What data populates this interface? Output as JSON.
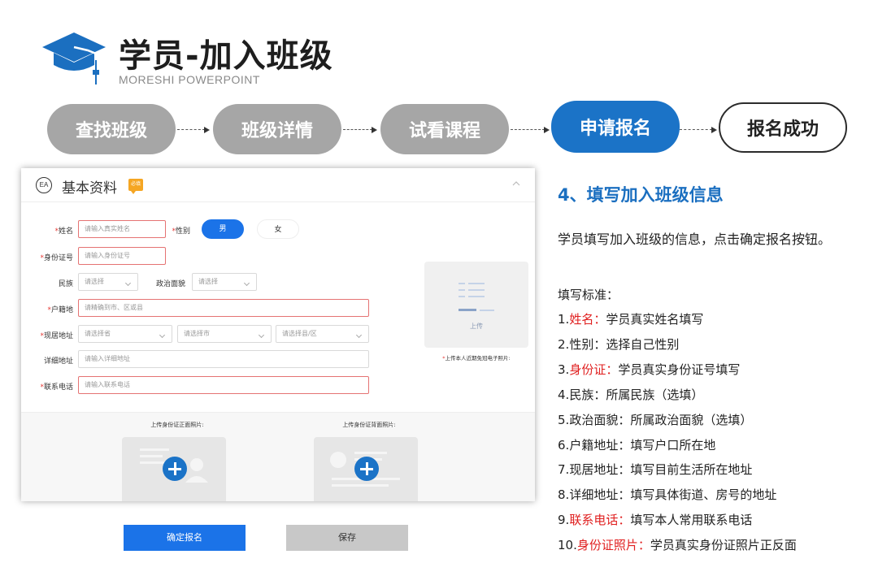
{
  "header": {
    "title": "学员-加入班级",
    "subtitle": "MORESHI POWERPOINT"
  },
  "steps": [
    {
      "label": "查找班级",
      "state": "completed"
    },
    {
      "label": "班级详情",
      "state": "completed"
    },
    {
      "label": "试看课程",
      "state": "completed"
    },
    {
      "label": "申请报名",
      "state": "current"
    },
    {
      "label": "报名成功",
      "state": "upcoming"
    }
  ],
  "form": {
    "section_title": "基本资料",
    "section_icon_text": "EA",
    "section_badge": "必填",
    "fields": {
      "name": {
        "label": "姓名",
        "placeholder": "请输入真实姓名"
      },
      "gender": {
        "label": "性别",
        "options": [
          "男",
          "女"
        ],
        "selected": "男"
      },
      "id_number": {
        "label": "身份证号",
        "placeholder": "请输入身份证号"
      },
      "ethnicity": {
        "label": "民族",
        "placeholder": "请选择"
      },
      "political_status": {
        "label": "政治面貌",
        "placeholder": "请选择"
      },
      "household": {
        "label": "户籍地",
        "placeholder": "请精确到市、区或县"
      },
      "current_address": {
        "label": "现居地址",
        "province": "请选择省",
        "city": "请选择市",
        "district": "请选择县/区"
      },
      "detail_address": {
        "label": "详细地址",
        "placeholder": "请输入详细地址"
      },
      "phone": {
        "label": "联系电话",
        "placeholder": "请输入联系电话"
      }
    },
    "photo": {
      "upload_label": "上传",
      "note": "上传本人近期免冠电子照片:"
    },
    "id_photos": {
      "front_label": "上传身份证正面照片:",
      "back_label": "上传身份证背面照片:"
    }
  },
  "buttons": {
    "submit": "确定报名",
    "save": "保存"
  },
  "panel": {
    "heading": "4、填写加入班级信息",
    "description": "学员填写加入班级的信息，点击确定报名按钮。",
    "standards_title": "填写标准：",
    "items": [
      {
        "num": "1.",
        "name": "姓名",
        "sep": "：",
        "desc": "学员真实姓名填写",
        "highlight": true
      },
      {
        "num": "2.",
        "name": "性别",
        "sep": "：",
        "desc": "选择自己性别",
        "highlight": false
      },
      {
        "num": "3.",
        "name": "身份证",
        "sep": "：",
        "desc": "学员真实身份证号填写",
        "highlight": true
      },
      {
        "num": "4.",
        "name": "民族",
        "sep": "：",
        "desc": "所属民族（选填）",
        "highlight": false
      },
      {
        "num": "5.",
        "name": "政治面貌",
        "sep": "：",
        "desc": "所属政治面貌（选填）",
        "highlight": false
      },
      {
        "num": "6.",
        "name": "户籍地址",
        "sep": "：",
        "desc": "填写户口所在地",
        "highlight": false
      },
      {
        "num": "7.",
        "name": "现居地址",
        "sep": "：",
        "desc": "填写目前生活所在地址",
        "highlight": false
      },
      {
        "num": "8.",
        "name": "详细地址",
        "sep": "：",
        "desc": "填写具体街道、房号的地址",
        "highlight": false
      },
      {
        "num": "9.",
        "name": "联系电话",
        "sep": "：",
        "desc": "填写本人常用联系电话",
        "highlight": true
      },
      {
        "num": "10.",
        "name": "身份证照片",
        "sep": "：",
        "desc": "学员真实身份证照片正反面",
        "highlight": true
      }
    ]
  },
  "colors": {
    "accent": "#1b73c7",
    "required": "#e53935",
    "step_gray": "#a6a6a6",
    "heading_blue": "#1b6fc0"
  }
}
